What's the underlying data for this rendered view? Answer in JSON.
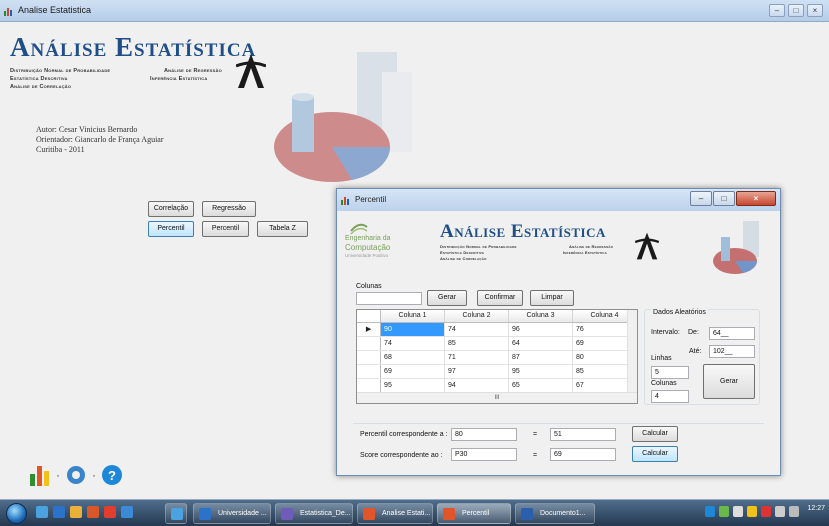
{
  "window": {
    "title": "Analise Estatistica"
  },
  "header": {
    "logo_title": "Análise Estatística",
    "sub_left": [
      "Distribuição Normal de Probabilidade",
      "Estatística Descritiva",
      "Análise de Correlação"
    ],
    "sub_right": [
      "Análise de Regressão",
      "Inferência Estatística"
    ]
  },
  "credits": {
    "author": "Autor: Cesar Vinicius Bernardo",
    "advisor": "Orientador: Giancarlo de França Aguiar",
    "place": "Curitiba - 2011"
  },
  "main_buttons": {
    "correlacao": "Correlação",
    "regressao": "Regressão",
    "percentil1": "Percentil",
    "percentil2": "Percentil",
    "tabela_z": "Tabela Z"
  },
  "dialog": {
    "title": "Percentil",
    "logo_left_1": "Engenharia da",
    "logo_left_2": "Computação",
    "logo_left_3": "Universidade Positivo",
    "logo_title": "Análise Estatística",
    "sub_left": [
      "Distribuição Normal de Probabilidade",
      "Estatística Descritiva",
      "Análise de Correlação"
    ],
    "sub_right": [
      "Análise de Regressão",
      "Inferência Estatística"
    ],
    "colunas_label": "Colunas",
    "colunas_value": "",
    "gerar_label": "Gerar",
    "confirmar_label": "Confirmar",
    "limpar_label": "Limpar",
    "grid": {
      "headers": [
        "Coluna 1",
        "Coluna 2",
        "Coluna 3",
        "Coluna 4"
      ],
      "rows": [
        [
          "90",
          "74",
          "96",
          "76"
        ],
        [
          "74",
          "85",
          "64",
          "69"
        ],
        [
          "68",
          "71",
          "87",
          "80"
        ],
        [
          "69",
          "97",
          "95",
          "85"
        ],
        [
          "95",
          "94",
          "65",
          "67"
        ]
      ],
      "hscroll_thumb": "III"
    },
    "random": {
      "title": "Dados Aleatórios",
      "intervalo_label": "Intervalo:",
      "de_label": "De:",
      "de_value": "64__",
      "ate_label": "Até:",
      "ate_value": "102__",
      "linhas_label": "Linhas",
      "linhas_value": "5",
      "colunas_label": "Colunas",
      "colunas_value": "4",
      "gerar_label": "Gerar"
    },
    "percentil_label": "Percentil correspondente a :",
    "percentil_input": "80",
    "percentil_eq": "=",
    "percentil_result": "51",
    "score_label": "Score correspondente ao :",
    "score_input": "P30",
    "score_eq": "=",
    "score_result": "69",
    "calcular1": "Calcular",
    "calcular2": "Calcular"
  },
  "taskbar": {
    "items": [
      "Universidade ...",
      "Estatistica_De...",
      "Analise Estati...",
      "Percentil",
      "Documento1..."
    ],
    "time": "12:27"
  },
  "colors": {
    "logo_blue": "#1f4e89",
    "selection": "#3399ff",
    "taskbar": "#2f4a66"
  }
}
